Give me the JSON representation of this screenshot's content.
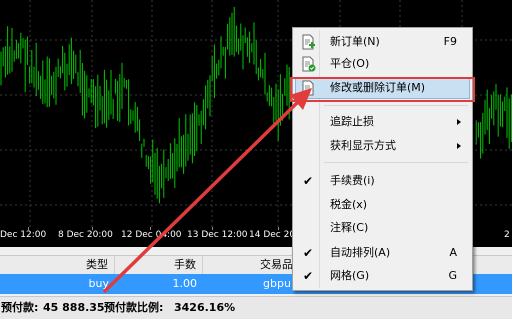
{
  "chart": {
    "time_labels": [
      "Dec 12:00",
      "8 Dec 20:00",
      "12 Dec 04:00",
      "13 Dec 12:00",
      "14 Dec 20:00",
      "2"
    ],
    "colors": {
      "background": "#000000",
      "candle": "#00c800",
      "grid": "#3a3a3a"
    }
  },
  "table": {
    "headers": [
      "类型",
      "手数",
      "交易品"
    ],
    "row": {
      "type": "buy",
      "lots": "1.00",
      "symbol": "gbpu"
    }
  },
  "status": {
    "prepaid_label": "预付款:",
    "prepaid_value": "45 888.35",
    "ratio_label": "预付款比例:",
    "ratio_value": "3426.16%"
  },
  "context_menu": {
    "items": [
      {
        "label": "新订单(N)",
        "shortcut": "F9",
        "icon": "new-order-icon"
      },
      {
        "label": "平仓(O)",
        "icon": "close-position-icon"
      },
      {
        "label": "修改或删除订单(M)",
        "icon": "modify-order-icon",
        "highlighted": true
      },
      {
        "label": "追踪止损",
        "submenu": true
      },
      {
        "label": "获利显示方式",
        "submenu": true
      },
      {
        "label": "手续费(i)",
        "checked": true
      },
      {
        "label": "税金(x)"
      },
      {
        "label": "注释(C)"
      },
      {
        "label": "自动排列(A)",
        "shortcut": "A",
        "checked": true
      },
      {
        "label": "网格(G)",
        "shortcut": "G",
        "checked": true
      }
    ]
  },
  "annotation": {
    "highlight_color": "#e03c3c"
  }
}
